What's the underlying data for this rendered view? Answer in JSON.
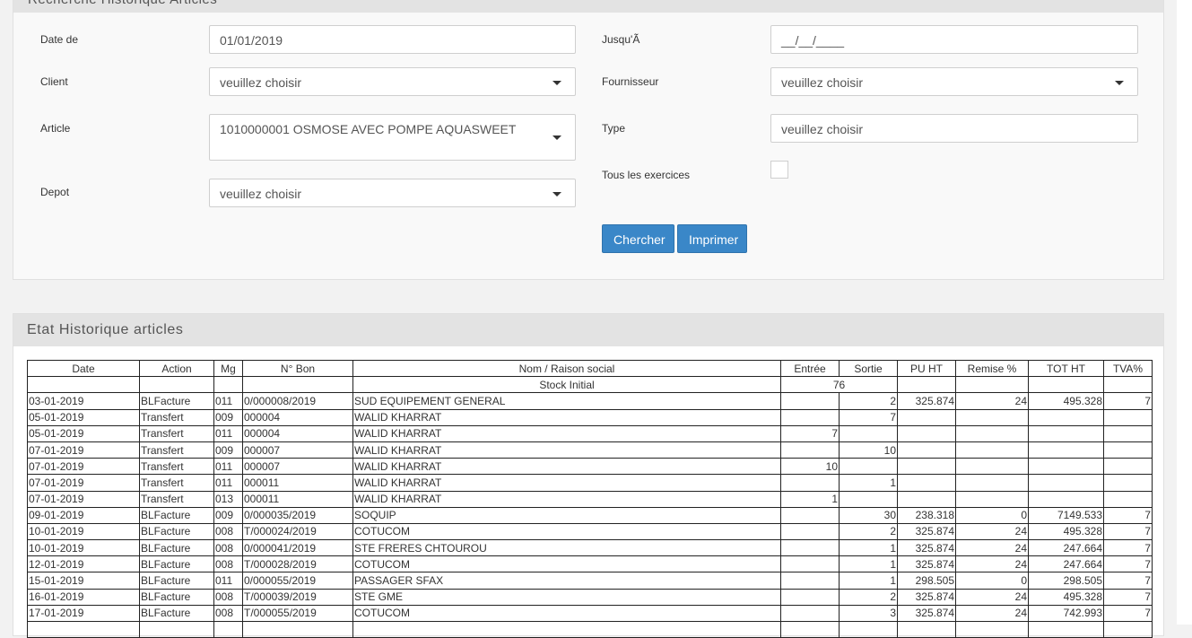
{
  "search": {
    "header_title": "Recherche Historique Articles",
    "date_de_label": "Date de",
    "date_de_value": "01/01/2019",
    "jusqua_label": "Jusqu'Ã",
    "jusqua_value": "__/__/____",
    "client_label": "Client",
    "client_value": "veuillez choisir",
    "fournisseur_label": "Fournisseur",
    "fournisseur_value": "veuillez choisir",
    "article_label": "Article",
    "article_value": "1010000001 OSMOSE AVEC POMPE AQUASWEET",
    "type_label": "Type",
    "type_value": "veuillez choisir",
    "exercices_label": "Tous les exercices",
    "depot_label": "Depot",
    "depot_value": "veuillez choisir",
    "chercher_label": "Chercher",
    "imprimer_label": "Imprimer"
  },
  "results": {
    "title": "Etat Historique articles",
    "columns": [
      "Date",
      "Action",
      "Mg",
      "N° Bon",
      "Nom / Raison social",
      "Entrée",
      "Sortie",
      "PU HT",
      "Remise %",
      "TOT HT",
      "TVA%"
    ],
    "initial_label": "Stock Initial",
    "initial_value": "76",
    "rows": [
      {
        "date": "03-01-2019",
        "action": "BLFacture",
        "mg": "011",
        "bon": "0/000008/2019",
        "nom": "SUD EQUIPEMENT GENERAL",
        "entree": "",
        "sortie": "2",
        "pu": "325.874",
        "remise": "24",
        "tot": "495.328",
        "tva": "7"
      },
      {
        "date": "05-01-2019",
        "action": "Transfert",
        "mg": "009",
        "bon": "000004",
        "nom": "WALID KHARRAT",
        "entree": "",
        "sortie": "7",
        "pu": "",
        "remise": "",
        "tot": "",
        "tva": ""
      },
      {
        "date": "05-01-2019",
        "action": "Transfert",
        "mg": "011",
        "bon": "000004",
        "nom": "WALID KHARRAT",
        "entree": "7",
        "sortie": "",
        "pu": "",
        "remise": "",
        "tot": "",
        "tva": ""
      },
      {
        "date": "07-01-2019",
        "action": "Transfert",
        "mg": "009",
        "bon": "000007",
        "nom": "WALID KHARRAT",
        "entree": "",
        "sortie": "10",
        "pu": "",
        "remise": "",
        "tot": "",
        "tva": ""
      },
      {
        "date": "07-01-2019",
        "action": "Transfert",
        "mg": "011",
        "bon": "000007",
        "nom": "WALID KHARRAT",
        "entree": "10",
        "sortie": "",
        "pu": "",
        "remise": "",
        "tot": "",
        "tva": ""
      },
      {
        "date": "07-01-2019",
        "action": "Transfert",
        "mg": "011",
        "bon": "000011",
        "nom": "WALID KHARRAT",
        "entree": "",
        "sortie": "1",
        "pu": "",
        "remise": "",
        "tot": "",
        "tva": ""
      },
      {
        "date": "07-01-2019",
        "action": "Transfert",
        "mg": "013",
        "bon": "000011",
        "nom": "WALID KHARRAT",
        "entree": "1",
        "sortie": "",
        "pu": "",
        "remise": "",
        "tot": "",
        "tva": ""
      },
      {
        "date": "09-01-2019",
        "action": "BLFacture",
        "mg": "009",
        "bon": "0/000035/2019",
        "nom": "SOQUIP",
        "entree": "",
        "sortie": "30",
        "pu": "238.318",
        "remise": "0",
        "tot": "7149.533",
        "tva": "7"
      },
      {
        "date": "10-01-2019",
        "action": "BLFacture",
        "mg": "008",
        "bon": "T/000024/2019",
        "nom": "COTUCOM",
        "entree": "",
        "sortie": "2",
        "pu": "325.874",
        "remise": "24",
        "tot": "495.328",
        "tva": "7"
      },
      {
        "date": "10-01-2019",
        "action": "BLFacture",
        "mg": "008",
        "bon": "0/000041/2019",
        "nom": "STE FRERES CHTOUROU",
        "entree": "",
        "sortie": "1",
        "pu": "325.874",
        "remise": "24",
        "tot": "247.664",
        "tva": "7"
      },
      {
        "date": "12-01-2019",
        "action": "BLFacture",
        "mg": "008",
        "bon": "T/000028/2019",
        "nom": "COTUCOM",
        "entree": "",
        "sortie": "1",
        "pu": "325.874",
        "remise": "24",
        "tot": "247.664",
        "tva": "7"
      },
      {
        "date": "15-01-2019",
        "action": "BLFacture",
        "mg": "011",
        "bon": "0/000055/2019",
        "nom": "PASSAGER SFAX",
        "entree": "",
        "sortie": "1",
        "pu": "298.505",
        "remise": "0",
        "tot": "298.505",
        "tva": "7"
      },
      {
        "date": "16-01-2019",
        "action": "BLFacture",
        "mg": "008",
        "bon": "T/000039/2019",
        "nom": "STE GME",
        "entree": "",
        "sortie": "2",
        "pu": "325.874",
        "remise": "24",
        "tot": "495.328",
        "tva": "7"
      },
      {
        "date": "17-01-2019",
        "action": "BLFacture",
        "mg": "008",
        "bon": "T/000055/2019",
        "nom": "COTUCOM",
        "entree": "",
        "sortie": "3",
        "pu": "325.874",
        "remise": "24",
        "tot": "742.993",
        "tva": "7"
      },
      {
        "date": "",
        "action": "",
        "mg": "",
        "bon": "",
        "nom": "",
        "entree": "",
        "sortie": "",
        "pu": "",
        "remise": "",
        "tot": "",
        "tva": ""
      }
    ]
  }
}
